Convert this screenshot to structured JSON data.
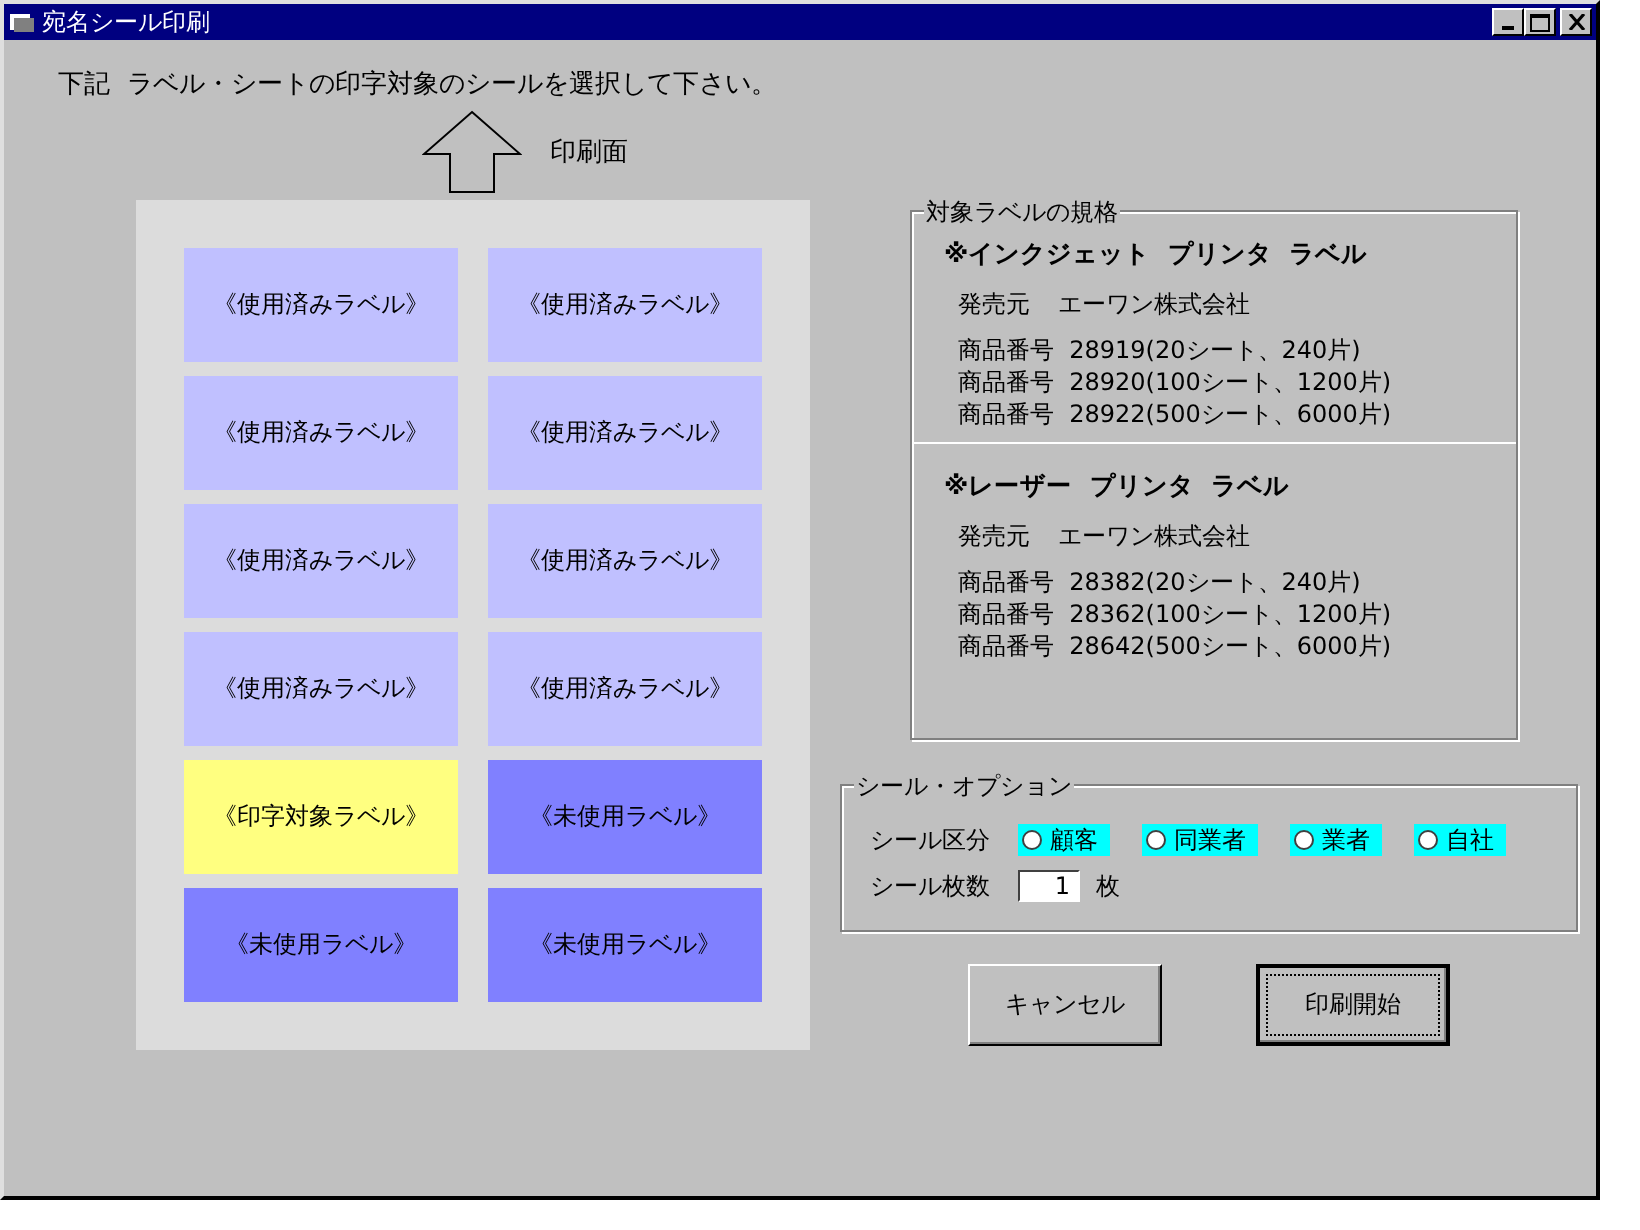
{
  "window": {
    "title": "宛名シール印刷"
  },
  "instruction": "下記  ラベル・シートの印字対象のシールを選択して下さい。",
  "print_side_label": "印刷面",
  "labels": [
    {
      "text": "《使用済みラベル》",
      "kind": "used"
    },
    {
      "text": "《使用済みラベル》",
      "kind": "used"
    },
    {
      "text": "《使用済みラベル》",
      "kind": "used"
    },
    {
      "text": "《使用済みラベル》",
      "kind": "used"
    },
    {
      "text": "《使用済みラベル》",
      "kind": "used"
    },
    {
      "text": "《使用済みラベル》",
      "kind": "used"
    },
    {
      "text": "《使用済みラベル》",
      "kind": "used"
    },
    {
      "text": "《使用済みラベル》",
      "kind": "used"
    },
    {
      "text": "《印字対象ラベル》",
      "kind": "target"
    },
    {
      "text": "《未使用ラベル》",
      "kind": "unused"
    },
    {
      "text": "《未使用ラベル》",
      "kind": "unused"
    },
    {
      "text": "《未使用ラベル》",
      "kind": "unused"
    }
  ],
  "spec": {
    "title": "対象ラベルの規格",
    "sections": [
      {
        "heading": "※インクジェット  プリンタ  ラベル",
        "vendor_label": "発売元",
        "vendor": "エーワン株式会社",
        "products": [
          "商品番号  28919(20シート、240片)",
          "商品番号  28920(100シート、1200片)",
          "商品番号  28922(500シート、6000片)"
        ]
      },
      {
        "heading": "※レーザー  プリンタ  ラベル",
        "vendor_label": "発売元",
        "vendor": "エーワン株式会社",
        "products": [
          "商品番号  28382(20シート、240片)",
          "商品番号  28362(100シート、1200片)",
          "商品番号  28642(500シート、6000片)"
        ]
      }
    ]
  },
  "options": {
    "title": "シール・オプション",
    "category_label": "シール区分",
    "categories": [
      {
        "label": "顧客",
        "selected": false
      },
      {
        "label": "同業者",
        "selected": false
      },
      {
        "label": "業者",
        "selected": false
      },
      {
        "label": "自社",
        "selected": false
      }
    ],
    "count_label": "シール枚数",
    "count_value": "1",
    "count_unit": "枚"
  },
  "buttons": [
    {
      "label": "キャンセル",
      "focused": false
    },
    {
      "label": "印刷開始",
      "focused": true
    }
  ]
}
